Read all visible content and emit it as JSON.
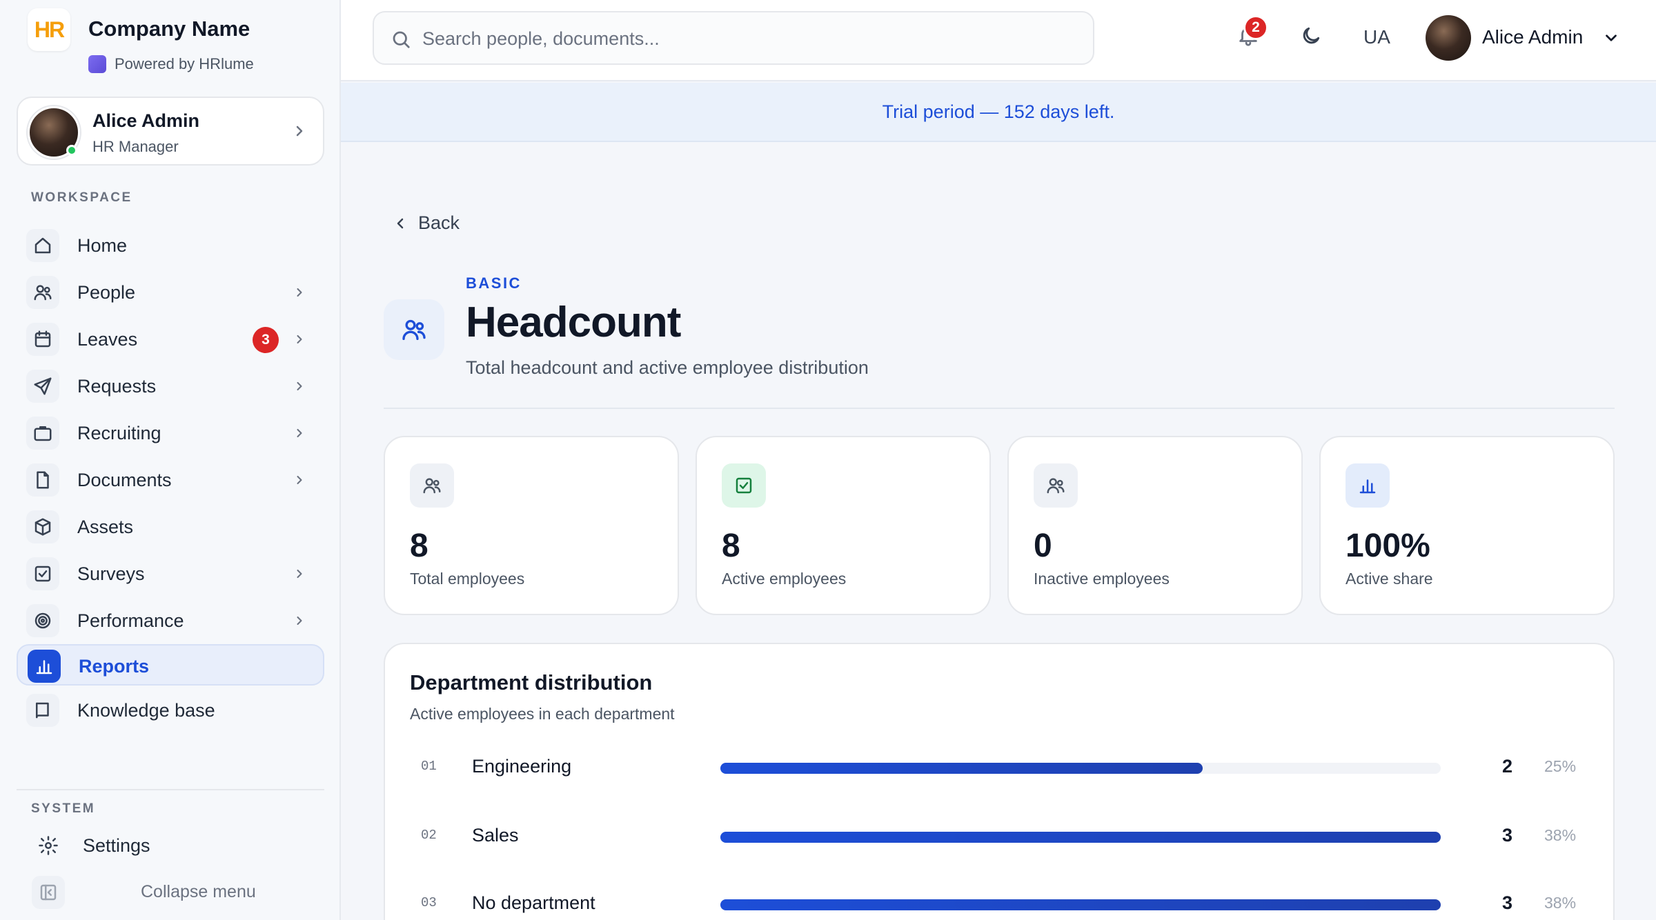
{
  "brand": {
    "name": "Company Name",
    "powered_by": "Powered by HRlume",
    "logo_text": "HR"
  },
  "sidebar": {
    "user": {
      "name": "Alice Admin",
      "role": "HR Manager"
    },
    "workspace_label": "WORKSPACE",
    "system_label": "SYSTEM",
    "items": [
      {
        "label": "Home",
        "icon": "home-icon"
      },
      {
        "label": "People",
        "icon": "users-icon"
      },
      {
        "label": "Leaves",
        "icon": "calendar-icon",
        "badge": "3"
      },
      {
        "label": "Requests",
        "icon": "send-icon"
      },
      {
        "label": "Recruiting",
        "icon": "briefcase-icon"
      },
      {
        "label": "Documents",
        "icon": "file-icon"
      },
      {
        "label": "Assets",
        "icon": "box-icon"
      },
      {
        "label": "Surveys",
        "icon": "check-square-icon"
      },
      {
        "label": "Performance",
        "icon": "target-icon"
      },
      {
        "label": "Reports",
        "icon": "bar-chart-icon",
        "active": true
      },
      {
        "label": "Knowledge base",
        "icon": "book-icon"
      }
    ],
    "settings_label": "Settings",
    "collapse_label": "Collapse menu"
  },
  "topbar": {
    "search_placeholder": "Search people, documents...",
    "notifications_count": "2",
    "language": "UA",
    "user_name": "Alice Admin"
  },
  "trial_banner": "Trial period — 152 days left.",
  "page": {
    "back_label": "Back",
    "eyebrow": "BASIC",
    "title": "Headcount",
    "subtitle": "Total headcount and active employee distribution"
  },
  "stats": [
    {
      "value": "8",
      "caption": "Total employees",
      "icon": "users-icon"
    },
    {
      "value": "8",
      "caption": "Active employees",
      "icon": "check-square-icon"
    },
    {
      "value": "0",
      "caption": "Inactive employees",
      "icon": "users-icon"
    },
    {
      "value": "100%",
      "caption": "Active share",
      "icon": "bar-chart-icon"
    }
  ],
  "distribution": {
    "title": "Department distribution",
    "subtitle": "Active employees in each department",
    "rows": [
      {
        "num": "01",
        "name": "Engineering",
        "count": "2",
        "pct": "25%",
        "fill": 0.67
      },
      {
        "num": "02",
        "name": "Sales",
        "count": "3",
        "pct": "38%",
        "fill": 1.0
      },
      {
        "num": "03",
        "name": "No department",
        "count": "3",
        "pct": "38%",
        "fill": 1.0
      }
    ]
  },
  "colors": {
    "accent": "#1d4ed8",
    "badge": "#dc2626",
    "online": "#22c55e"
  }
}
